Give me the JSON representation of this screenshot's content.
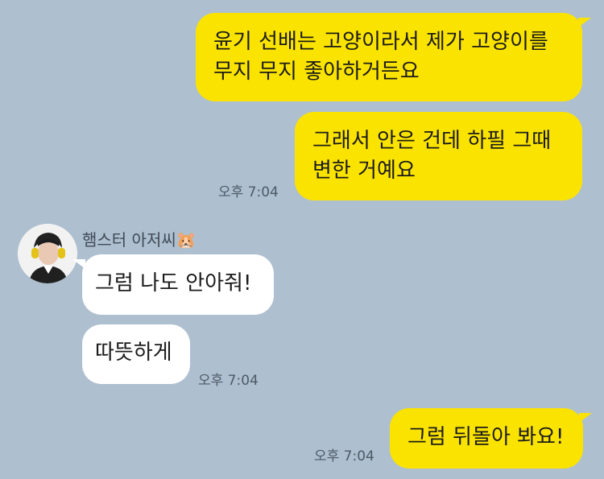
{
  "messages": {
    "sent_1": {
      "lines": [
        "윤기 선배는 고양이라서 제가 고양이를",
        "무지 무지 좋아하거든요"
      ]
    },
    "sent_2": {
      "lines": [
        "그래서 안은 건데 하필 그때",
        "변한 거예요"
      ],
      "time": "오후 7:04"
    },
    "recv_1": {
      "sender": "햄스터 아저씨",
      "sender_emoji": "🐹",
      "text": "그럼 나도 안아줘!"
    },
    "recv_2": {
      "text": "따뜻하게",
      "time": "오후 7:04"
    },
    "sent_3": {
      "text": "그럼 뒤돌아 봐요!",
      "time": "오후 7:04"
    }
  },
  "colors": {
    "background": "#aebfcf",
    "sent_bubble": "#fbe300",
    "received_bubble": "#ffffff"
  },
  "icons": {
    "avatar": "profile-photo-headphones",
    "sender_emoji": "hamster-face"
  }
}
